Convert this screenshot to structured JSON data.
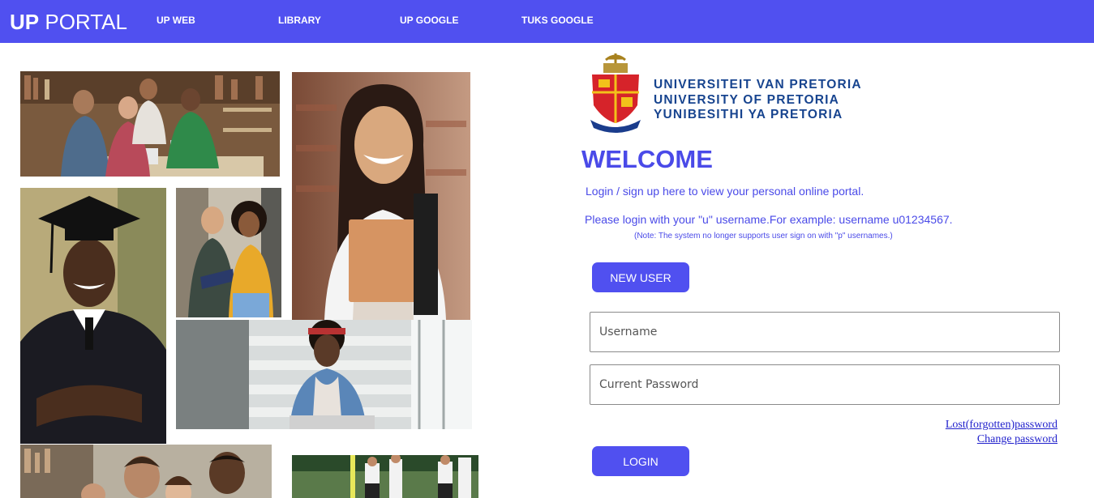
{
  "header": {
    "brand_bold": "UP",
    "brand_rest": " PORTAL",
    "nav": [
      {
        "label": "UP WEB"
      },
      {
        "label": "LIBRARY"
      },
      {
        "label": "UP GOOGLE"
      },
      {
        "label": "TUKS GOOGLE"
      }
    ]
  },
  "university": {
    "names": [
      "UNIVERSITEIT VAN PRETORIA",
      "UNIVERSITY OF PRETORIA",
      "YUNIBESITHI YA PRETORIA"
    ]
  },
  "login": {
    "welcome": "WELCOME",
    "intro": "Login / sign up here to view your personal online portal.",
    "hint": "Please login with your \"u\" username.For example: username u01234567.",
    "note": "(Note: The system no longer supports user sign on with \"p\" usernames.)",
    "new_user_label": "NEW USER",
    "username_placeholder": "Username",
    "password_placeholder": "Current Password",
    "lost_password_link": "Lost(forgotten)password",
    "change_password_link": "Change password",
    "login_label": "LOGIN"
  },
  "colors": {
    "accent": "#5050f0",
    "university_blue": "#17448f",
    "link": "#2020cc"
  }
}
